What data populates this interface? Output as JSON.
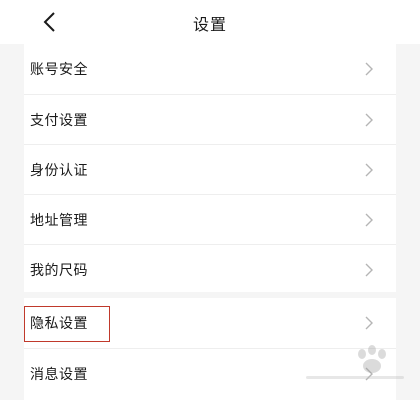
{
  "header": {
    "title": "设置"
  },
  "menu_group_1": [
    {
      "label": "账号安全"
    },
    {
      "label": "支付设置"
    },
    {
      "label": "身份认证"
    },
    {
      "label": "地址管理"
    },
    {
      "label": "我的尺码"
    }
  ],
  "menu_group_2": [
    {
      "label": "隐私设置"
    },
    {
      "label": "消息设置"
    }
  ],
  "icons": {
    "back": "chevron-left-icon",
    "row": "chevron-right-icon"
  },
  "colors": {
    "highlight": "#c0392b",
    "background": "#f5f5f5",
    "surface": "#ffffff"
  }
}
